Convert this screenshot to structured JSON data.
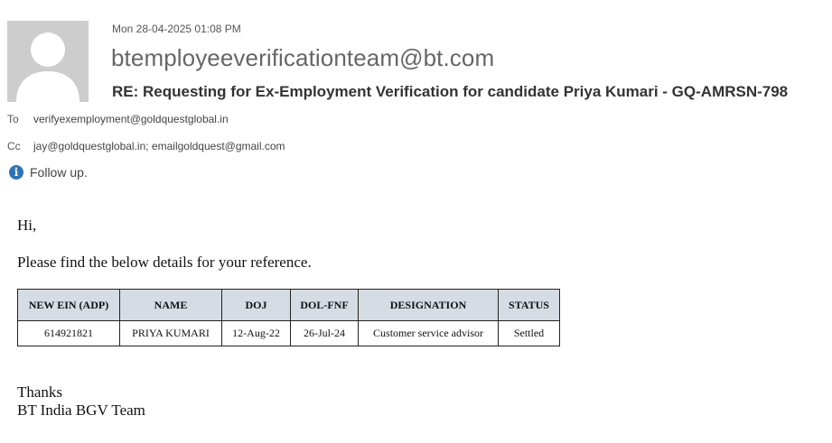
{
  "email": {
    "sent_time": "Mon 28-04-2025 01:08 PM",
    "sender": "btemployeeverificationteam@bt.com",
    "subject": "RE: Requesting for Ex-Employment Verification for candidate Priya Kumari - GQ-AMRSN-798",
    "to_label": "To",
    "to": "verifyexemployment@goldquestglobal.in",
    "cc_label": "Cc",
    "cc": "jay@goldquestglobal.in; emailgoldquest@gmail.com",
    "followup": "Follow up.",
    "info_icon": "info-icon",
    "avatar_icon": "person-placeholder-icon",
    "accent_color": "#2e74b5"
  },
  "body": {
    "greeting": "Hi,",
    "intro": "Please find the below details for your reference.",
    "table": {
      "headers": [
        "NEW EIN (ADP)",
        "NAME",
        "DOJ",
        "DOL-FNF",
        "DESIGNATION",
        "STATUS"
      ],
      "rows": [
        [
          "614921821",
          "PRIYA KUMARI",
          "12-Aug-22",
          "26-Jul-24",
          "Customer service advisor",
          "Settled"
        ]
      ],
      "header_bg": "#d6dce4"
    },
    "closing": "Thanks",
    "signature": "BT India BGV Team"
  }
}
